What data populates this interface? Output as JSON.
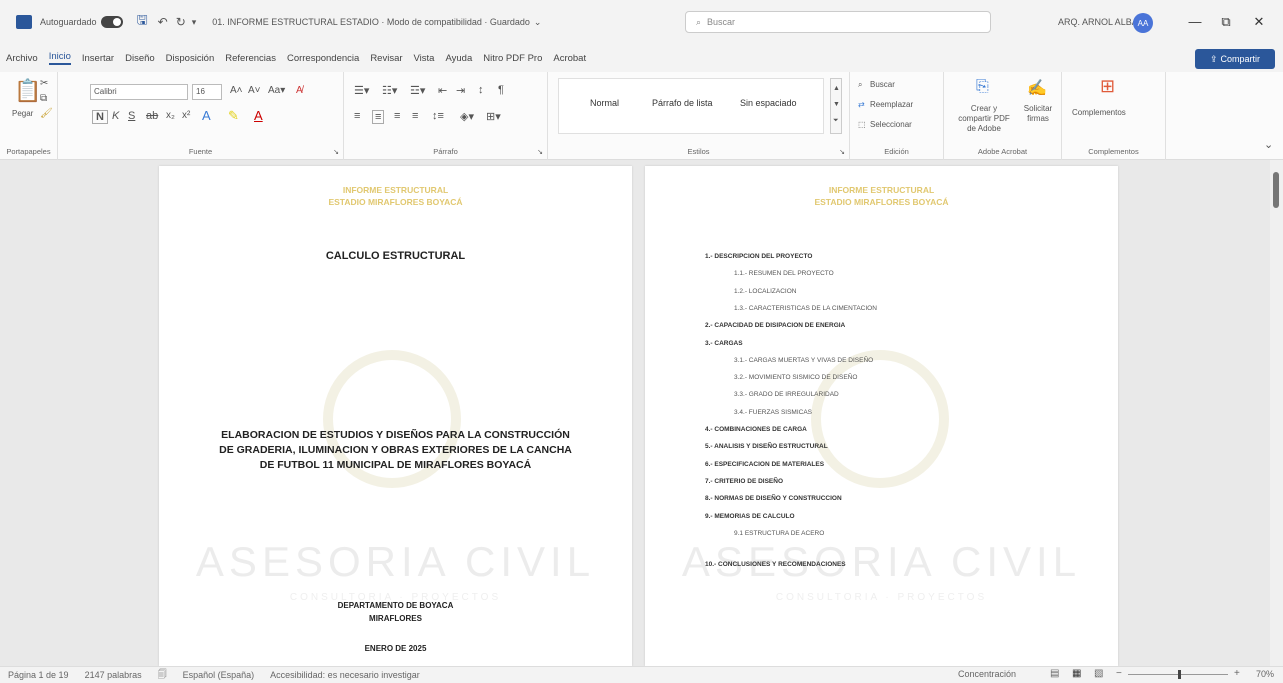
{
  "titlebar": {
    "autosave_label": "Autoguardado",
    "doc_title": "01. INFORME ESTRUCTURAL ESTADIO · Modo de compatibilidad · Guardado",
    "search_placeholder": "Buscar",
    "user_name": "ARQ. ARNOL ALBA",
    "user_initials": "AA"
  },
  "menu": {
    "items": [
      "Archivo",
      "Inicio",
      "Insertar",
      "Diseño",
      "Disposición",
      "Referencias",
      "Correspondencia",
      "Revisar",
      "Vista",
      "Ayuda",
      "Nitro PDF Pro",
      "Acrobat"
    ],
    "share_label": "Compartir"
  },
  "ribbon": {
    "clipboard": {
      "paste": "Pegar",
      "label": "Portapapeles"
    },
    "font": {
      "name": "Calibri",
      "size": "16",
      "label": "Fuente"
    },
    "paragraph": {
      "label": "Párrafo"
    },
    "styles": {
      "items": [
        "Normal",
        "Párrafo de lista",
        "Sin espaciado"
      ],
      "label": "Estilos"
    },
    "editing": {
      "find": "Buscar",
      "replace": "Reemplazar",
      "select": "Seleccionar",
      "label": "Edición"
    },
    "acrobat": {
      "create": "Crear y compartir PDF de Adobe",
      "sign": "Solicitar firmas",
      "label": "Adobe Acrobat"
    },
    "addins": {
      "btn": "Complementos",
      "label": "Complementos"
    }
  },
  "page1": {
    "header_line1": "INFORME ESTRUCTURAL",
    "header_line2": "ESTADIO MIRAFLORES BOYACÁ",
    "title": "CALCULO ESTRUCTURAL",
    "body_line1": "ELABORACION DE ESTUDIOS Y DISEÑOS PARA LA CONSTRUCCIÓN",
    "body_line2": "DE GRADERIA, ILUMINACION Y OBRAS EXTERIORES DE LA CANCHA",
    "body_line3": "DE FUTBOL 11 MUNICIPAL DE MIRAFLORES BOYACÁ",
    "watermark": "ASESORIA CIVIL",
    "watermark_sub": "CONSULTORIA · PROYECTOS",
    "footer_line1": "DEPARTAMENTO DE BOYACA",
    "footer_line2": "MIRAFLORES",
    "footer_line3": "ENERO DE 2025"
  },
  "page2": {
    "header_line1": "INFORME ESTRUCTURAL",
    "header_line2": "ESTADIO MIRAFLORES BOYACÁ",
    "watermark": "ASESORIA CIVIL",
    "watermark_sub": "CONSULTORIA · PROYECTOS",
    "toc": [
      {
        "text": "1.- DESCRIPCION DEL PROYECTO",
        "level": 0
      },
      {
        "text": "1.1.- RESUMEN DEL PROYECTO",
        "level": 1
      },
      {
        "text": "1.2.- LOCALIZACION",
        "level": 1
      },
      {
        "text": "1.3.- CARACTERISTICAS DE LA CIMENTACION",
        "level": 1
      },
      {
        "text": "2.- CAPACIDAD DE DISIPACION DE ENERGIA",
        "level": 0
      },
      {
        "text": "3.- CARGAS",
        "level": 0
      },
      {
        "text": "3.1.- CARGAS MUERTAS Y VIVAS DE DISEÑO",
        "level": 1
      },
      {
        "text": "3.2.- MOVIMIENTO SISMICO DE DISEÑO",
        "level": 1
      },
      {
        "text": "3.3.- GRADO DE IRREGULARIDAD",
        "level": 1
      },
      {
        "text": "3.4.- FUERZAS SISMICAS",
        "level": 1
      },
      {
        "text": "4.- COMBINACIONES DE CARGA",
        "level": 0
      },
      {
        "text": "5.- ANALISIS Y DISEÑO ESTRUCTURAL",
        "level": 0
      },
      {
        "text": "6.- ESPECIFICACION DE MATERIALES",
        "level": 0
      },
      {
        "text": "7.- CRITERIO DE DISEÑO",
        "level": 0
      },
      {
        "text": "8.- NORMAS DE DISEÑO Y CONSTRUCCION",
        "level": 0
      },
      {
        "text": "9.- MEMORIAS DE CALCULO",
        "level": 0
      },
      {
        "text": "9.1 ESTRUCTURA DE ACERO",
        "level": 1
      },
      {
        "text": "10.- CONCLUSIONES Y RECOMENDACIONES",
        "level": 0
      }
    ]
  },
  "status": {
    "page": "Página 1 de 19",
    "words": "2147 palabras",
    "language": "Español (España)",
    "accessibility": "Accesibilidad: es necesario investigar",
    "focus": "Concentración",
    "zoom": "70%"
  },
  "colors": {
    "accent": "#2b579a",
    "header_gold": "#e1c870"
  }
}
